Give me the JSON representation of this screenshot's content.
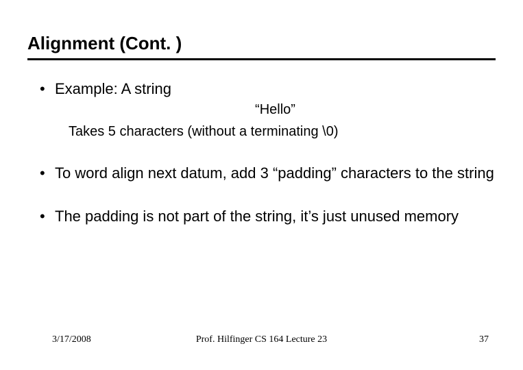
{
  "title": "Alignment (Cont. )",
  "bullets": [
    {
      "text": "Example: A string",
      "sub_center": "“Hello”",
      "sub": "Takes 5 characters (without a terminating \\0)"
    },
    {
      "text": "To word align next datum, add 3 “padding” characters to the string"
    },
    {
      "text": "The padding is not part of the string, it’s just unused memory"
    }
  ],
  "footer": {
    "date": "3/17/2008",
    "center": "Prof. Hilfinger  CS 164  Lecture 23",
    "page": "37"
  }
}
